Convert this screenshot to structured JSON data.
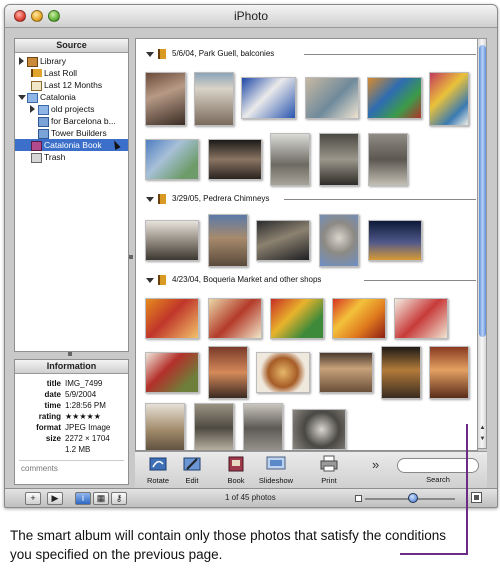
{
  "window": {
    "title": "iPhoto"
  },
  "source": {
    "header": "Source",
    "items": [
      {
        "label": "Library",
        "icon": "library-icon"
      },
      {
        "label": "Last Roll",
        "icon": "film-roll-icon"
      },
      {
        "label": "Last 12 Months",
        "icon": "calendar-icon"
      },
      {
        "label": "Catalonia",
        "icon": "folder-icon"
      },
      {
        "label": "old projects",
        "icon": "folder-icon"
      },
      {
        "label": "for Barcelona b...",
        "icon": "album-icon"
      },
      {
        "label": "Tower Builders",
        "icon": "album-icon"
      },
      {
        "label": "Catalonia Book",
        "icon": "book-icon"
      },
      {
        "label": "Trash",
        "icon": "trash-icon"
      }
    ]
  },
  "info": {
    "header": "Information",
    "rows": [
      {
        "key": "title",
        "value": "IMG_7499"
      },
      {
        "key": "date",
        "value": "5/9/2004"
      },
      {
        "key": "time",
        "value": "1:28:56 PM"
      },
      {
        "key": "rating",
        "value": "★★★★★"
      },
      {
        "key": "format",
        "value": "JPEG Image"
      },
      {
        "key": "size",
        "value": "2272 × 1704"
      },
      {
        "key": "",
        "value": "1.2 MB"
      }
    ],
    "comments_placeholder": "comments"
  },
  "rolls": [
    {
      "title": "5/6/04, Park Guell, balconies",
      "photo_count": 12
    },
    {
      "title": "3/29/05, Pedrera Chimneys",
      "photo_count": 5
    },
    {
      "title": "4/23/04, Boqueria Market and other shops",
      "photo_count": 16
    }
  ],
  "toolbar": {
    "buttons": [
      {
        "label": "Rotate",
        "icon": "rotate-icon"
      },
      {
        "label": "Edit",
        "icon": "edit-icon"
      },
      {
        "label": "Book",
        "icon": "book-icon"
      },
      {
        "label": "Slideshow",
        "icon": "slideshow-icon"
      },
      {
        "label": "Print",
        "icon": "print-icon"
      }
    ],
    "more": "»",
    "search_label": "Search"
  },
  "bottombar": {
    "add": "+",
    "play": "▶",
    "status": "1 of 45 photos"
  },
  "caption": "The smart album will contain only those photos that satisfy the conditions you specified on the previous page."
}
